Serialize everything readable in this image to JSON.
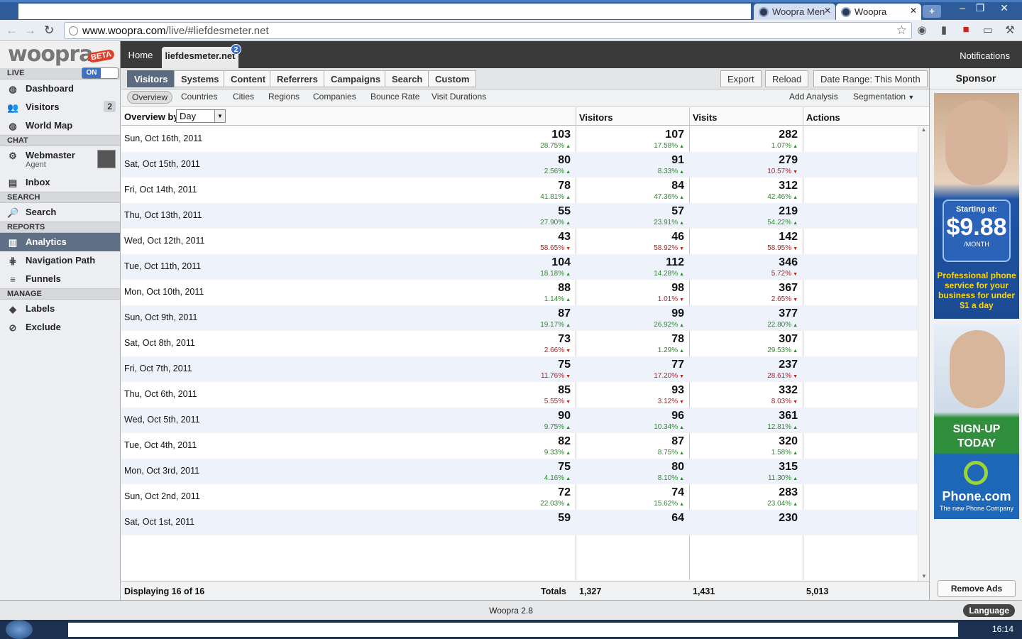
{
  "browser": {
    "tabs": [
      {
        "label": "Woopra Men"
      },
      {
        "label": "Woopra"
      }
    ],
    "url_domain": "www.woopra.com",
    "url_path": "/live/#liefdesmeter.net"
  },
  "header": {
    "logo": "woopra",
    "beta": "BETA",
    "home": "Home",
    "site": "liefdesmeter.net",
    "site_badge": "2",
    "notifications": "Notifications"
  },
  "sidebar": {
    "live_label": "LIVE",
    "live_toggle": "ON",
    "live_items": [
      {
        "label": "Dashboard",
        "icon": "globe-icon"
      },
      {
        "label": "Visitors",
        "icon": "users-icon",
        "count": "2"
      },
      {
        "label": "World Map",
        "icon": "globe-icon"
      }
    ],
    "chat_label": "CHAT",
    "agent_name": "Webmaster",
    "agent_role": "Agent",
    "inbox": "Inbox",
    "search_label": "SEARCH",
    "search": "Search",
    "reports_label": "REPORTS",
    "report_items": [
      {
        "label": "Analytics",
        "icon": "bar-chart-icon"
      },
      {
        "label": "Navigation Path",
        "icon": "path-icon"
      },
      {
        "label": "Funnels",
        "icon": "funnel-icon"
      }
    ],
    "manage_label": "MANAGE",
    "manage_items": [
      {
        "label": "Labels",
        "icon": "tag-icon"
      },
      {
        "label": "Exclude",
        "icon": "block-icon"
      }
    ]
  },
  "toolbar": {
    "tabs": [
      "Visitors",
      "Systems",
      "Content",
      "Referrers",
      "Campaigns",
      "Search",
      "Custom"
    ],
    "export": "Export",
    "reload": "Reload",
    "date_range": "Date Range: This Month",
    "subtabs": [
      "Overview",
      "Countries",
      "Cities",
      "Regions",
      "Companies",
      "Bounce Rate",
      "Visit Durations"
    ],
    "add_analysis": "Add Analysis",
    "segmentation": "Segmentation"
  },
  "grid": {
    "overview_by": "Overview by",
    "period": "Day",
    "columns": [
      "Visitors",
      "Visits",
      "Actions"
    ],
    "rows": [
      {
        "date": "Sun, Oct 16th, 2011",
        "v": "103",
        "vp": "28.75%",
        "vd": "up",
        "s": "107",
        "sp": "17.58%",
        "sd": "up",
        "a": "282",
        "ap": "1.07%",
        "ad": "up"
      },
      {
        "date": "Sat, Oct 15th, 2011",
        "v": "80",
        "vp": "2.56%",
        "vd": "up",
        "s": "91",
        "sp": "8.33%",
        "sd": "up",
        "a": "279",
        "ap": "10.57%",
        "ad": "dn"
      },
      {
        "date": "Fri, Oct 14th, 2011",
        "v": "78",
        "vp": "41.81%",
        "vd": "up",
        "s": "84",
        "sp": "47.36%",
        "sd": "up",
        "a": "312",
        "ap": "42.46%",
        "ad": "up"
      },
      {
        "date": "Thu, Oct 13th, 2011",
        "v": "55",
        "vp": "27.90%",
        "vd": "up",
        "s": "57",
        "sp": "23.91%",
        "sd": "up",
        "a": "219",
        "ap": "54.22%",
        "ad": "up"
      },
      {
        "date": "Wed, Oct 12th, 2011",
        "v": "43",
        "vp": "58.65%",
        "vd": "dn",
        "s": "46",
        "sp": "58.92%",
        "sd": "dn",
        "a": "142",
        "ap": "58.95%",
        "ad": "dn"
      },
      {
        "date": "Tue, Oct 11th, 2011",
        "v": "104",
        "vp": "18.18%",
        "vd": "up",
        "s": "112",
        "sp": "14.28%",
        "sd": "up",
        "a": "346",
        "ap": "5.72%",
        "ad": "dn"
      },
      {
        "date": "Mon, Oct 10th, 2011",
        "v": "88",
        "vp": "1.14%",
        "vd": "up",
        "s": "98",
        "sp": "1.01%",
        "sd": "dn",
        "a": "367",
        "ap": "2.65%",
        "ad": "dn"
      },
      {
        "date": "Sun, Oct 9th, 2011",
        "v": "87",
        "vp": "19.17%",
        "vd": "up",
        "s": "99",
        "sp": "26.92%",
        "sd": "up",
        "a": "377",
        "ap": "22.80%",
        "ad": "up"
      },
      {
        "date": "Sat, Oct 8th, 2011",
        "v": "73",
        "vp": "2.66%",
        "vd": "dn",
        "s": "78",
        "sp": "1.29%",
        "sd": "up",
        "a": "307",
        "ap": "29.53%",
        "ad": "up"
      },
      {
        "date": "Fri, Oct 7th, 2011",
        "v": "75",
        "vp": "11.76%",
        "vd": "dn",
        "s": "77",
        "sp": "17.20%",
        "sd": "dn",
        "a": "237",
        "ap": "28.61%",
        "ad": "dn"
      },
      {
        "date": "Thu, Oct 6th, 2011",
        "v": "85",
        "vp": "5.55%",
        "vd": "dn",
        "s": "93",
        "sp": "3.12%",
        "sd": "dn",
        "a": "332",
        "ap": "8.03%",
        "ad": "dn"
      },
      {
        "date": "Wed, Oct 5th, 2011",
        "v": "90",
        "vp": "9.75%",
        "vd": "up",
        "s": "96",
        "sp": "10.34%",
        "sd": "up",
        "a": "361",
        "ap": "12.81%",
        "ad": "up"
      },
      {
        "date": "Tue, Oct 4th, 2011",
        "v": "82",
        "vp": "9.33%",
        "vd": "up",
        "s": "87",
        "sp": "8.75%",
        "sd": "up",
        "a": "320",
        "ap": "1.58%",
        "ad": "up"
      },
      {
        "date": "Mon, Oct 3rd, 2011",
        "v": "75",
        "vp": "4.16%",
        "vd": "up",
        "s": "80",
        "sp": "8.10%",
        "sd": "up",
        "a": "315",
        "ap": "11.30%",
        "ad": "up"
      },
      {
        "date": "Sun, Oct 2nd, 2011",
        "v": "72",
        "vp": "22.03%",
        "vd": "up",
        "s": "74",
        "sp": "15.62%",
        "sd": "up",
        "a": "283",
        "ap": "23.04%",
        "ad": "up"
      },
      {
        "date": "Sat, Oct 1st, 2011",
        "v": "59",
        "vp": "",
        "vd": "",
        "s": "64",
        "sp": "",
        "sd": "",
        "a": "230",
        "ap": "",
        "ad": ""
      }
    ],
    "displaying": "Displaying 16 of 16",
    "totals_label": "Totals",
    "totals": [
      "1,327",
      "1,431",
      "5,013"
    ]
  },
  "sponsor": {
    "title": "Sponsor",
    "ad1_starting": "Starting at:",
    "ad1_price": "$9.88",
    "ad1_month": "/MONTH",
    "ad1_text": "Professional phone service for your business for under $1 a day",
    "ad2_signup": "SIGN-UP TODAY",
    "ad2_brand": "Phone.com",
    "ad2_tag": "The new Phone Company",
    "remove_ads": "Remove Ads"
  },
  "footer": {
    "version": "Woopra 2.8",
    "language": "Language"
  },
  "taskbar": {
    "clock": "16:14"
  },
  "colors": {
    "up": "#2c8a2c",
    "down": "#b52020",
    "active_tab": "#5d6b80",
    "row_alt": "#eef3fb"
  }
}
